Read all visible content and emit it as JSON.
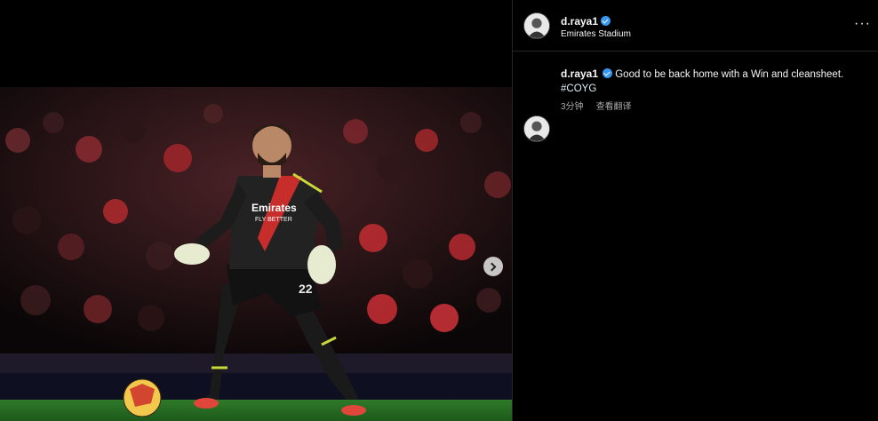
{
  "header": {
    "username": "d.raya1",
    "location": "Emirates Stadium",
    "more_label": "···"
  },
  "post": {
    "username": "d.raya1",
    "caption": "Good to be back home with a Win and cleansheet.",
    "hashtag": "#COYG",
    "time_ago": "3分钟",
    "translate_label": "查看翻译"
  },
  "photo": {
    "shirt_sponsor_line1": "Emirates",
    "shirt_sponsor_line2": "FLY BETTER",
    "shirt_number": "22"
  },
  "icons": {
    "verified": "verified-badge-icon",
    "next": "chevron-right-icon",
    "more": "more-options-icon"
  },
  "colors": {
    "background": "#000000",
    "verified_blue": "#3897f0",
    "secondary_text": "#a8a8a8"
  }
}
